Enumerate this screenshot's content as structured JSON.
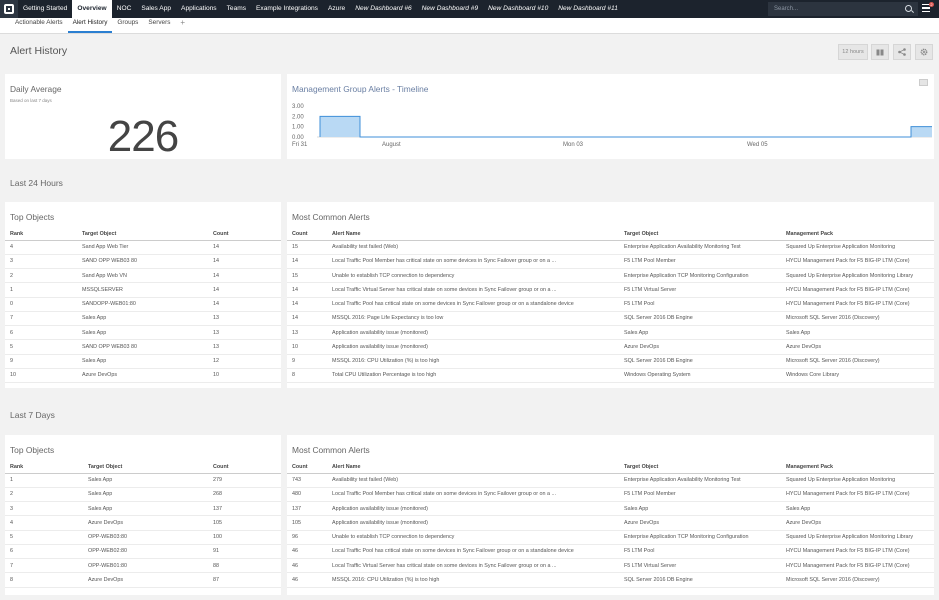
{
  "nav": {
    "items": [
      "Getting Started",
      "Overview",
      "NOC",
      "Sales App",
      "Applications",
      "Teams",
      "Example Integrations",
      "Azure",
      "New Dashboard #6",
      "New Dashboard #9",
      "New Dashboard #10",
      "New Dashboard #11"
    ],
    "active": "Overview",
    "italic": [
      "New Dashboard #6",
      "New Dashboard #9",
      "New Dashboard #10",
      "New Dashboard #11"
    ],
    "search_placeholder": "Search...",
    "notification_count": "2"
  },
  "subnav": {
    "items": [
      "Actionable Alerts",
      "Alert History",
      "Groups",
      "Servers"
    ],
    "active": "Alert History",
    "add_label": "+"
  },
  "page": {
    "title": "Alert History",
    "time_range": "12 hours"
  },
  "daily_average": {
    "title": "Daily Average",
    "subtitle": "Based on last 7 days",
    "value": "226"
  },
  "timeline": {
    "title": "Management Group Alerts - Timeline",
    "y_ticks": [
      "3.00",
      "2.00",
      "1.00",
      "0.00"
    ],
    "x_ticks": [
      "Fri 31",
      "August",
      "Mon 03",
      "Wed 05"
    ]
  },
  "chart_data": {
    "type": "area",
    "title": "Management Group Alerts - Timeline",
    "ylim": [
      0,
      3
    ],
    "y_ticks": [
      0,
      1,
      2,
      3
    ],
    "x_ticks": [
      "Fri 31",
      "August",
      "Mon 03",
      "Wed 05"
    ],
    "series": [
      {
        "values": [
          {
            "x": "Fri 31",
            "y": 0
          },
          {
            "x": "Fri 31",
            "y": 2
          },
          {
            "x": "Fri 31",
            "y": 2
          },
          {
            "x": "Fri 31",
            "y": 0
          },
          {
            "x": "Wed 05",
            "y": 0
          },
          {
            "x": "Wed 05",
            "y": 1
          },
          {
            "x": "Wed 05",
            "y": 1
          }
        ]
      }
    ]
  },
  "last24": {
    "label": "Last 24 Hours",
    "top_objects": {
      "title": "Top Objects",
      "columns": [
        "Rank",
        "Target Object",
        "Count"
      ],
      "rows": [
        [
          "4",
          "Sand App Web Tier",
          "14"
        ],
        [
          "3",
          "SAND OPP WEB03 80",
          "14"
        ],
        [
          "2",
          "Sand App Web VN",
          "14"
        ],
        [
          "1",
          "MSSQLSERVER",
          "14"
        ],
        [
          "0",
          "SANDOPP-WEB01:80",
          "14"
        ],
        [
          "7",
          "Sales App",
          "13"
        ],
        [
          "6",
          "Sales App",
          "13"
        ],
        [
          "5",
          "SAND OPP WEB03 80",
          "13"
        ],
        [
          "9",
          "Sales App",
          "12"
        ],
        [
          "10",
          "Azure DevOps",
          "10"
        ]
      ]
    },
    "common_alerts": {
      "title": "Most Common Alerts",
      "columns": [
        "Count",
        "Alert Name",
        "Target Object",
        "Management Pack"
      ],
      "rows": [
        [
          "15",
          "Availability test failed (Web)",
          "Enterprise Application Availability Monitoring Test",
          "Squared Up Enterprise Application Monitoring"
        ],
        [
          "14",
          "Local Traffic Pool Member has critical state on some devices in Sync Failover group or on a ...",
          "F5 LTM Pool Member",
          "HYCU Management Pack for F5 BIG-IP LTM (Core)"
        ],
        [
          "15",
          "Unable to establish TCP connection to dependency",
          "Enterprise Application TCP Monitoring Configuration",
          "Squared Up Enterprise Application Monitoring Library"
        ],
        [
          "14",
          "Local Traffic Virtual Server has critical state on some devices in Sync Failover group or on a ...",
          "F5 LTM Virtual Server",
          "HYCU Management Pack for F5 BIG-IP LTM (Core)"
        ],
        [
          "14",
          "Local Traffic Pool has critical state on some devices in Sync Failover group or on a standalone device",
          "F5 LTM Pool",
          "HYCU Management Pack for F5 BIG-IP LTM (Core)"
        ],
        [
          "14",
          "MSSQL 2016: Page Life Expectancy is too low",
          "SQL Server 2016 DB Engine",
          "Microsoft SQL Server 2016 (Discovery)"
        ],
        [
          "13",
          "Application availability issue (monitored)",
          "Sales App",
          "Sales App"
        ],
        [
          "10",
          "Application availability issue (monitored)",
          "Azure DevOps",
          "Azure DevOps"
        ],
        [
          "9",
          "MSSQL 2016: CPU Utilization (%) is too high",
          "SQL Server 2016 DB Engine",
          "Microsoft SQL Server 2016 (Discovery)"
        ],
        [
          "8",
          "Total CPU Utilization Percentage is too high",
          "Windows Operating System",
          "Windows Core Library"
        ]
      ]
    }
  },
  "last7": {
    "label": "Last 7 Days",
    "top_objects": {
      "title": "Top Objects",
      "columns": [
        "Rank",
        "Target Object",
        "Count"
      ],
      "rows": [
        [
          "1",
          "Sales App",
          "279"
        ],
        [
          "2",
          "Sales App",
          "268"
        ],
        [
          "3",
          "Sales App",
          "137"
        ],
        [
          "4",
          "Azure DevOps",
          "105"
        ],
        [
          "5",
          "OPP-WEB03:80",
          "100"
        ],
        [
          "6",
          "OPP-WEB02:80",
          "91"
        ],
        [
          "7",
          "OPP-WEB01:80",
          "88"
        ],
        [
          "8",
          "Azure DevOps",
          "87"
        ]
      ]
    },
    "common_alerts": {
      "title": "Most Common Alerts",
      "columns": [
        "Count",
        "Alert Name",
        "Target Object",
        "Management Pack"
      ],
      "rows": [
        [
          "743",
          "Availability test failed (Web)",
          "Enterprise Application Availability Monitoring Test",
          "Squared Up Enterprise Application Monitoring"
        ],
        [
          "480",
          "Local Traffic Pool Member has critical state on some devices in Sync Failover group or on a ...",
          "F5 LTM Pool Member",
          "HYCU Management Pack for F5 BIG-IP LTM (Core)"
        ],
        [
          "137",
          "Application availability issue (monitored)",
          "Sales App",
          "Sales App"
        ],
        [
          "105",
          "Application availability issue (monitored)",
          "Azure DevOps",
          "Azure DevOps"
        ],
        [
          "96",
          "Unable to establish TCP connection to dependency",
          "Enterprise Application TCP Monitoring Configuration",
          "Squared Up Enterprise Application Monitoring Library"
        ],
        [
          "46",
          "Local Traffic Pool has critical state on some devices in Sync Failover group or on a standalone device",
          "F5 LTM Pool",
          "HYCU Management Pack for F5 BIG-IP LTM (Core)"
        ],
        [
          "46",
          "Local Traffic Virtual Server has critical state on some devices in Sync Failover group or on a ...",
          "F5 LTM Virtual Server",
          "HYCU Management Pack for F5 BIG-IP LTM (Core)"
        ],
        [
          "46",
          "MSSQL 2016: CPU Utilization (%) is too high",
          "SQL Server 2016 DB Engine",
          "Microsoft SQL Server 2016 (Discovery)"
        ]
      ]
    }
  },
  "colors": {
    "nav_bg": "#1c232d",
    "accent": "#2b7fd1",
    "chart_fill": "#b9d9f4",
    "chart_line": "#3f8fd8"
  }
}
